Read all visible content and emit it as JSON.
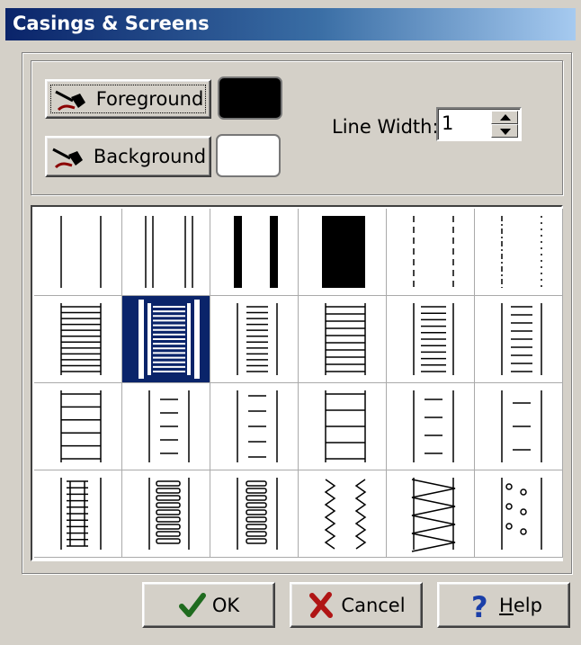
{
  "window": {
    "title": "Casings & Screens"
  },
  "colors": {
    "foreground": "#000000",
    "background": "#ffffff",
    "selection": "#0a246a"
  },
  "color_buttons": {
    "foreground_label": "Foreground",
    "background_label": "Background",
    "icon": "paint-brush-icon"
  },
  "line_width": {
    "label": "Line Width:",
    "value": "1"
  },
  "patterns": {
    "selected_index": 7,
    "cells": [
      "pattern-1",
      "pattern-2",
      "pattern-3",
      "pattern-4",
      "pattern-5",
      "pattern-6",
      "pattern-7",
      "pattern-8",
      "pattern-9",
      "pattern-10",
      "pattern-11",
      "pattern-12",
      "pattern-13",
      "pattern-14",
      "pattern-15",
      "pattern-16",
      "pattern-17",
      "pattern-18",
      "pattern-19",
      "pattern-20",
      "pattern-21",
      "pattern-22",
      "pattern-23",
      "pattern-24"
    ]
  },
  "buttons": {
    "ok": {
      "label": "OK",
      "icon": "checkmark-icon"
    },
    "cancel": {
      "label": "Cancel",
      "icon": "x-icon"
    },
    "help": {
      "label_prefix": "H",
      "label_rest": "elp",
      "icon": "question-mark-icon"
    }
  }
}
